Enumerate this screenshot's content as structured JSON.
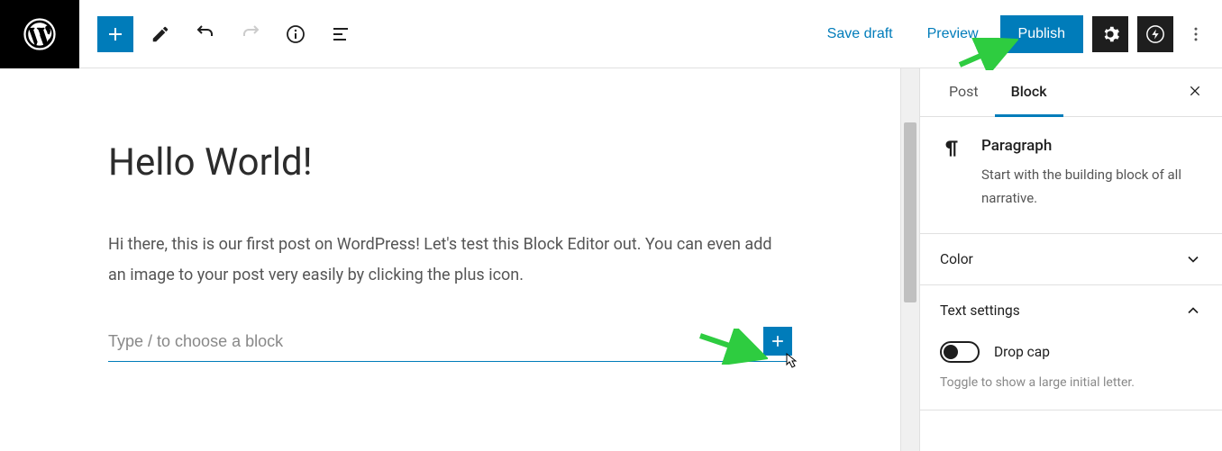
{
  "toolbar": {
    "save_draft": "Save draft",
    "preview": "Preview",
    "publish": "Publish"
  },
  "editor": {
    "title": "Hello World!",
    "paragraph": "Hi there, this is our first post on WordPress! Let's test this Block Editor out. You can even add an image to your post very easily by clicking the plus icon.",
    "placeholder": "Type / to choose a block"
  },
  "sidebar": {
    "tabs": {
      "post": "Post",
      "block": "Block"
    },
    "block": {
      "name": "Paragraph",
      "desc": "Start with the building block of all narrative."
    },
    "panels": {
      "color": "Color",
      "text": "Text settings"
    },
    "dropcap": {
      "label": "Drop cap",
      "hint": "Toggle to show a large initial letter."
    }
  }
}
